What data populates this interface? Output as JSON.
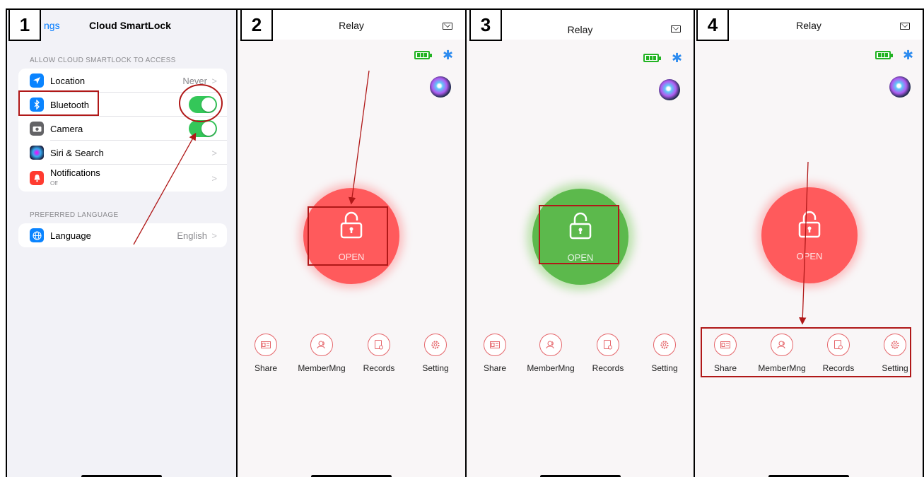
{
  "steps": [
    "1",
    "2",
    "3",
    "4"
  ],
  "settings": {
    "back_label": "ngs",
    "title": "Cloud SmartLock",
    "section_access": "ALLOW CLOUD SMARTLOCK TO ACCESS",
    "rows": [
      {
        "label": "Location",
        "value": "Never",
        "icon": "location-icon",
        "color": "#0a84ff"
      },
      {
        "label": "Bluetooth",
        "toggle": true,
        "icon": "bluetooth-icon",
        "color": "#0a84ff"
      },
      {
        "label": "Camera",
        "toggle": true,
        "icon": "camera-icon",
        "color": "#636366"
      },
      {
        "label": "Siri & Search",
        "icon": "siri-icon",
        "color": "#2c2c54"
      },
      {
        "label": "Notifications",
        "sub": "Off",
        "icon": "notifications-icon",
        "color": "#ff3b30"
      }
    ],
    "section_language": "PREFERRED LANGUAGE",
    "language": {
      "label": "Language",
      "value": "English",
      "icon": "globe-icon",
      "color": "#0a84ff"
    }
  },
  "app": {
    "title": "Relay",
    "open_label": "OPEN",
    "nav": [
      "Share",
      "MemberMng",
      "Records",
      "Setting"
    ]
  },
  "colors": {
    "lock_red": "#ff5a5c",
    "lock_green": "#5cb94c",
    "annotation": "#b01818",
    "toggle_on": "#34c759"
  }
}
